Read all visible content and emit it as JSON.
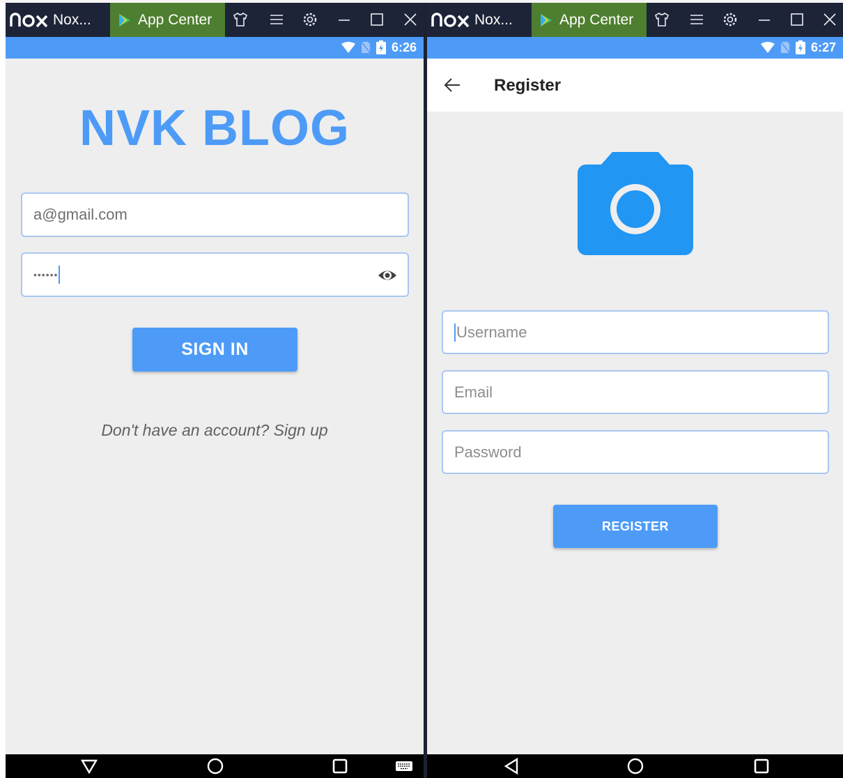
{
  "window_left": {
    "nox_label": "Nox...",
    "app_center_label": "App Center"
  },
  "window_right": {
    "nox_label": "Nox...",
    "app_center_label": "App Center"
  },
  "status_left": {
    "time": "6:26"
  },
  "status_right": {
    "time": "6:27"
  },
  "login": {
    "app_title": "NVK BLOG",
    "email_value": "a@gmail.com",
    "password_value": "••••••",
    "sign_in_label": "SIGN IN",
    "signup_prompt": "Don't have an account? Sign up"
  },
  "register": {
    "title": "Register",
    "username_placeholder": "Username",
    "email_placeholder": "Email",
    "password_placeholder": "Password",
    "register_label": "REGISTER"
  },
  "colors": {
    "accent": "#4d9bf7",
    "titlebar": "#1d2438",
    "app_center_tab": "#4e7e2f",
    "background": "#eeeeee"
  },
  "icons": [
    "nox-logo-icon",
    "play-store-icon",
    "shirt-icon",
    "menu-icon",
    "gear-icon",
    "minimize-icon",
    "maximize-icon",
    "close-icon",
    "wifi-icon",
    "no-sim-icon",
    "battery-icon",
    "eye-icon",
    "back-arrow-icon",
    "camera-icon",
    "nav-back-icon",
    "nav-home-icon",
    "nav-recents-icon",
    "keyboard-icon"
  ]
}
